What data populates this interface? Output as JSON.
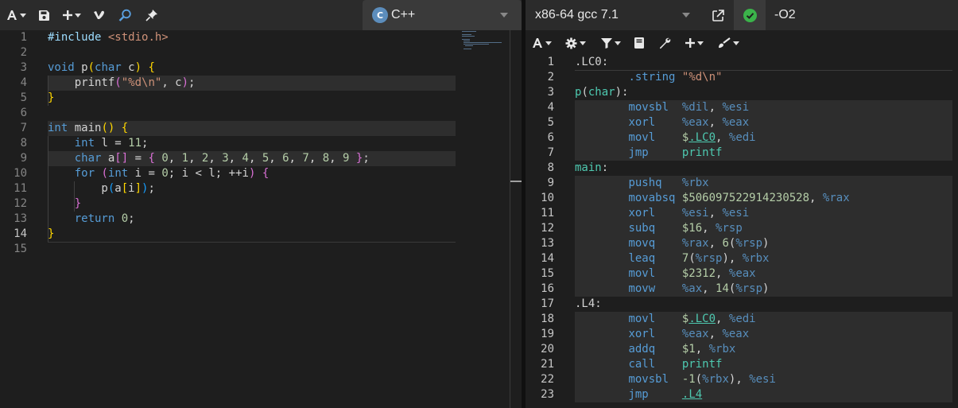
{
  "source": {
    "language": "C++",
    "lines": [
      {
        "n": "1",
        "html": "<span class=\"inc\">#include</span> <span class=\"incf\">&lt;stdio.h&gt;</span>"
      },
      {
        "n": "2",
        "html": ""
      },
      {
        "n": "3",
        "html": "<span class=\"kw\">void</span> p<span class=\"p1\">(</span><span class=\"kw\">char</span> c<span class=\"p1\">)</span> <span class=\"p1\">{</span>"
      },
      {
        "n": "4",
        "html": "    printf<span class=\"p2\">(</span><span class=\"str\">\"%d\\n\"</span>, c<span class=\"p2\">)</span>;"
      },
      {
        "n": "5",
        "html": "<span class=\"p1\">}</span>"
      },
      {
        "n": "6",
        "html": ""
      },
      {
        "n": "7",
        "html": "<span class=\"kw\">int</span> main<span class=\"p1\">()</span> <span class=\"p1\">{</span>"
      },
      {
        "n": "8",
        "html": "    <span class=\"kw\">int</span> l = <span class=\"num\">11</span>;"
      },
      {
        "n": "9",
        "html": "    <span class=\"kw\">char</span> a<span class=\"p2\">[]</span> = <span class=\"p2\">{</span> <span class=\"num\">0</span>, <span class=\"num\">1</span>, <span class=\"num\">2</span>, <span class=\"num\">3</span>, <span class=\"num\">4</span>, <span class=\"num\">5</span>, <span class=\"num\">6</span>, <span class=\"num\">7</span>, <span class=\"num\">8</span>, <span class=\"num\">9</span> <span class=\"p2\">}</span>;"
      },
      {
        "n": "10",
        "html": "    <span class=\"kw\">for</span> <span class=\"p2\">(</span><span class=\"kw\">int</span> i = <span class=\"num\">0</span>; i &lt; l; ++i<span class=\"p2\">)</span> <span class=\"p2\">{</span>"
      },
      {
        "n": "11",
        "html": "        p<span class=\"p3\">(</span>a<span class=\"p1\">[</span>i<span class=\"p1\">]</span><span class=\"p3\">)</span>;"
      },
      {
        "n": "12",
        "html": "    <span class=\"p2\">}</span>"
      },
      {
        "n": "13",
        "html": "    <span class=\"kw\">return</span> <span class=\"num\">0</span>;"
      },
      {
        "n": "14",
        "html": "<span class=\"p1\">}</span>"
      },
      {
        "n": "15",
        "html": ""
      }
    ],
    "current_line": "14"
  },
  "compiler": {
    "name": "x86-64 gcc 7.1",
    "options": "-O2",
    "lines": [
      {
        "n": "1",
        "html": "<span class=\"lblp\">.LC0</span>:"
      },
      {
        "n": "2",
        "html": "        <span class=\"dir\">.string</span> <span class=\"str\">\"%d\\n\"</span>"
      },
      {
        "n": "3",
        "html": "<span class=\"lbl\">p</span><span class=\"lblp\">(</span><span class=\"lbl\">char</span><span class=\"lblp\">)</span>:"
      },
      {
        "n": "4",
        "html": "        <span class=\"ins\">movsbl</span>  <span class=\"reg\">%dil</span>, <span class=\"reg\">%esi</span>"
      },
      {
        "n": "5",
        "html": "        <span class=\"ins\">xorl</span>    <span class=\"reg\">%eax</span>, <span class=\"reg\">%eax</span>"
      },
      {
        "n": "6",
        "html": "        <span class=\"ins\">movl</span>    <span class=\"imm\">$</span><span class=\"sym\">.LC0</span>, <span class=\"reg\">%edi</span>"
      },
      {
        "n": "7",
        "html": "        <span class=\"ins\">jmp</span>     <span class=\"lbl\">printf</span>"
      },
      {
        "n": "8",
        "html": "<span class=\"lbl\">main</span>:"
      },
      {
        "n": "9",
        "html": "        <span class=\"ins\">pushq</span>   <span class=\"reg\">%rbx</span>"
      },
      {
        "n": "10",
        "html": "        <span class=\"ins\">movabsq</span> <span class=\"imm\">$506097522914230528</span>, <span class=\"reg\">%rax</span>"
      },
      {
        "n": "11",
        "html": "        <span class=\"ins\">xorl</span>    <span class=\"reg\">%esi</span>, <span class=\"reg\">%esi</span>"
      },
      {
        "n": "12",
        "html": "        <span class=\"ins\">subq</span>    <span class=\"imm\">$16</span>, <span class=\"reg\">%rsp</span>"
      },
      {
        "n": "13",
        "html": "        <span class=\"ins\">movq</span>    <span class=\"reg\">%rax</span>, <span class=\"imm\">6</span>(<span class=\"reg\">%rsp</span>)"
      },
      {
        "n": "14",
        "html": "        <span class=\"ins\">leaq</span>    <span class=\"imm\">7</span>(<span class=\"reg\">%rsp</span>), <span class=\"reg\">%rbx</span>"
      },
      {
        "n": "15",
        "html": "        <span class=\"ins\">movl</span>    <span class=\"imm\">$2312</span>, <span class=\"reg\">%eax</span>"
      },
      {
        "n": "16",
        "html": "        <span class=\"ins\">movw</span>    <span class=\"reg\">%ax</span>, <span class=\"imm\">14</span>(<span class=\"reg\">%rsp</span>)"
      },
      {
        "n": "17",
        "html": "<span class=\"lblp\">.L4</span>:"
      },
      {
        "n": "18",
        "html": "        <span class=\"ins\">movl</span>    <span class=\"imm\">$</span><span class=\"sym\">.LC0</span>, <span class=\"reg\">%edi</span>"
      },
      {
        "n": "19",
        "html": "        <span class=\"ins\">xorl</span>    <span class=\"reg\">%eax</span>, <span class=\"reg\">%eax</span>"
      },
      {
        "n": "20",
        "html": "        <span class=\"ins\">addq</span>    <span class=\"imm\">$1</span>, <span class=\"reg\">%rbx</span>"
      },
      {
        "n": "21",
        "html": "        <span class=\"ins\">call</span>    <span class=\"lbl\">printf</span>"
      },
      {
        "n": "22",
        "html": "        <span class=\"ins\">movsbl</span>  <span class=\"imm\">-1</span>(<span class=\"reg\">%rbx</span>), <span class=\"reg\">%esi</span>"
      },
      {
        "n": "23",
        "html": "        <span class=\"ins\">jmp</span>     <span class=\"sym\">.L4</span>"
      }
    ]
  },
  "icons": {
    "font": "font-icon",
    "save": "save-icon",
    "add": "plus-icon",
    "vim": "vim-icon",
    "cppinsights": "magnifier-icon",
    "quickbench": "pin-icon",
    "popout": "external-link-icon",
    "status": "check-circle-icon",
    "settings": "gear-icon",
    "filter": "filter-icon",
    "libraries": "book-icon",
    "tools": "wrench-icon",
    "pipeline": "brush-icon"
  },
  "colors": {
    "background": "#1e1e1e",
    "toolbar": "#2b2b2b",
    "status_ok": "#3bb34a"
  }
}
